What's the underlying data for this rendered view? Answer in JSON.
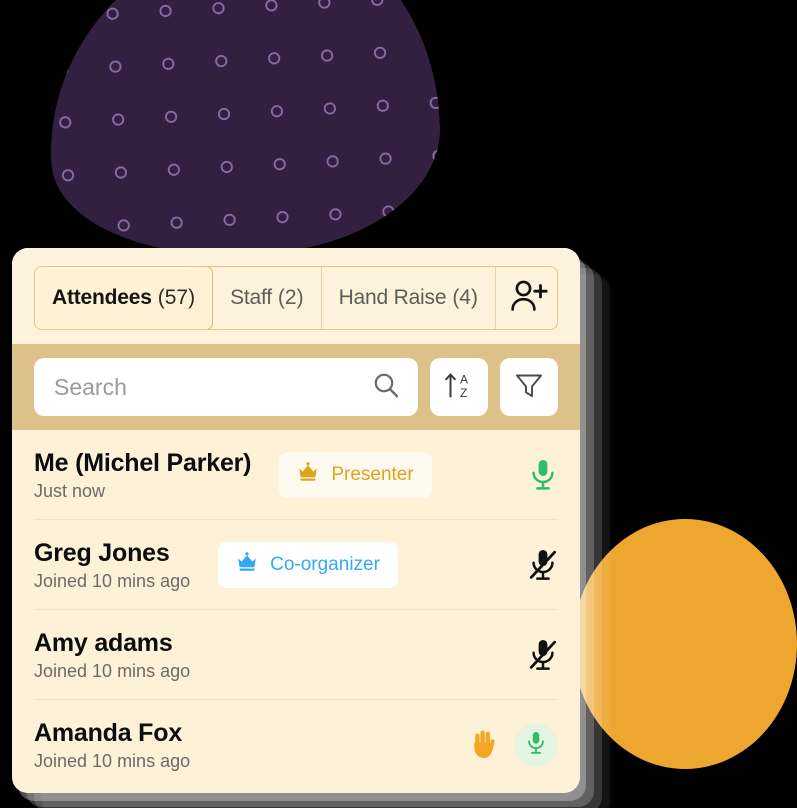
{
  "theme": {
    "card_bg": "#fdf3dd",
    "list_bg": "#fdf1d8",
    "search_band_bg": "#dcc288",
    "accent_gold": "#e0a31d",
    "accent_blue": "#34a9f2",
    "accent_green": "#2fbd6a",
    "accent_orange": "#f5a623",
    "blob_purple": "#332040",
    "blob_dot": "#8a6aa8",
    "circle_orange": "#eda72e"
  },
  "tabs": [
    {
      "name": "Attendees",
      "count": "(57)",
      "active": true,
      "key": "attendees"
    },
    {
      "name": "Staff",
      "count": "(2)",
      "active": false,
      "key": "staff"
    },
    {
      "name": "Hand Raise",
      "count": "(4)",
      "active": false,
      "key": "hand-raise"
    }
  ],
  "tab_actions": {
    "add_person_icon": "add-person-icon"
  },
  "search": {
    "placeholder": "Search",
    "value": "",
    "search_icon": "search-icon",
    "sort_icon": "sort-alpha-ascending-icon",
    "sort_label_top": "A",
    "sort_label_bottom": "Z",
    "filter_icon": "filter-funnel-icon"
  },
  "attendees": [
    {
      "name": "Me (Michel Parker)",
      "status": "Just now",
      "badge": {
        "label": "Presenter",
        "style": "presenter",
        "icon": "crown-icon"
      },
      "actions": [
        {
          "icon": "microphone-on-icon",
          "state": "unmuted",
          "style": "plain-green"
        }
      ]
    },
    {
      "name": "Greg Jones",
      "status": "Joined 10 mins ago",
      "badge": {
        "label": "Co-organizer",
        "style": "coorganizer",
        "icon": "crown-icon"
      },
      "actions": [
        {
          "icon": "microphone-muted-icon",
          "state": "muted",
          "style": "plain-black"
        }
      ]
    },
    {
      "name": "Amy adams",
      "status": "Joined 10 mins ago",
      "badge": null,
      "actions": [
        {
          "icon": "microphone-muted-icon",
          "state": "muted",
          "style": "plain-black"
        }
      ]
    },
    {
      "name": "Amanda Fox",
      "status": "Joined 10 mins ago",
      "badge": null,
      "actions": [
        {
          "icon": "raised-hand-icon",
          "state": "hand-raised",
          "style": "plain-orange"
        },
        {
          "icon": "microphone-on-icon",
          "state": "unmuted",
          "style": "circle-green"
        }
      ]
    }
  ]
}
